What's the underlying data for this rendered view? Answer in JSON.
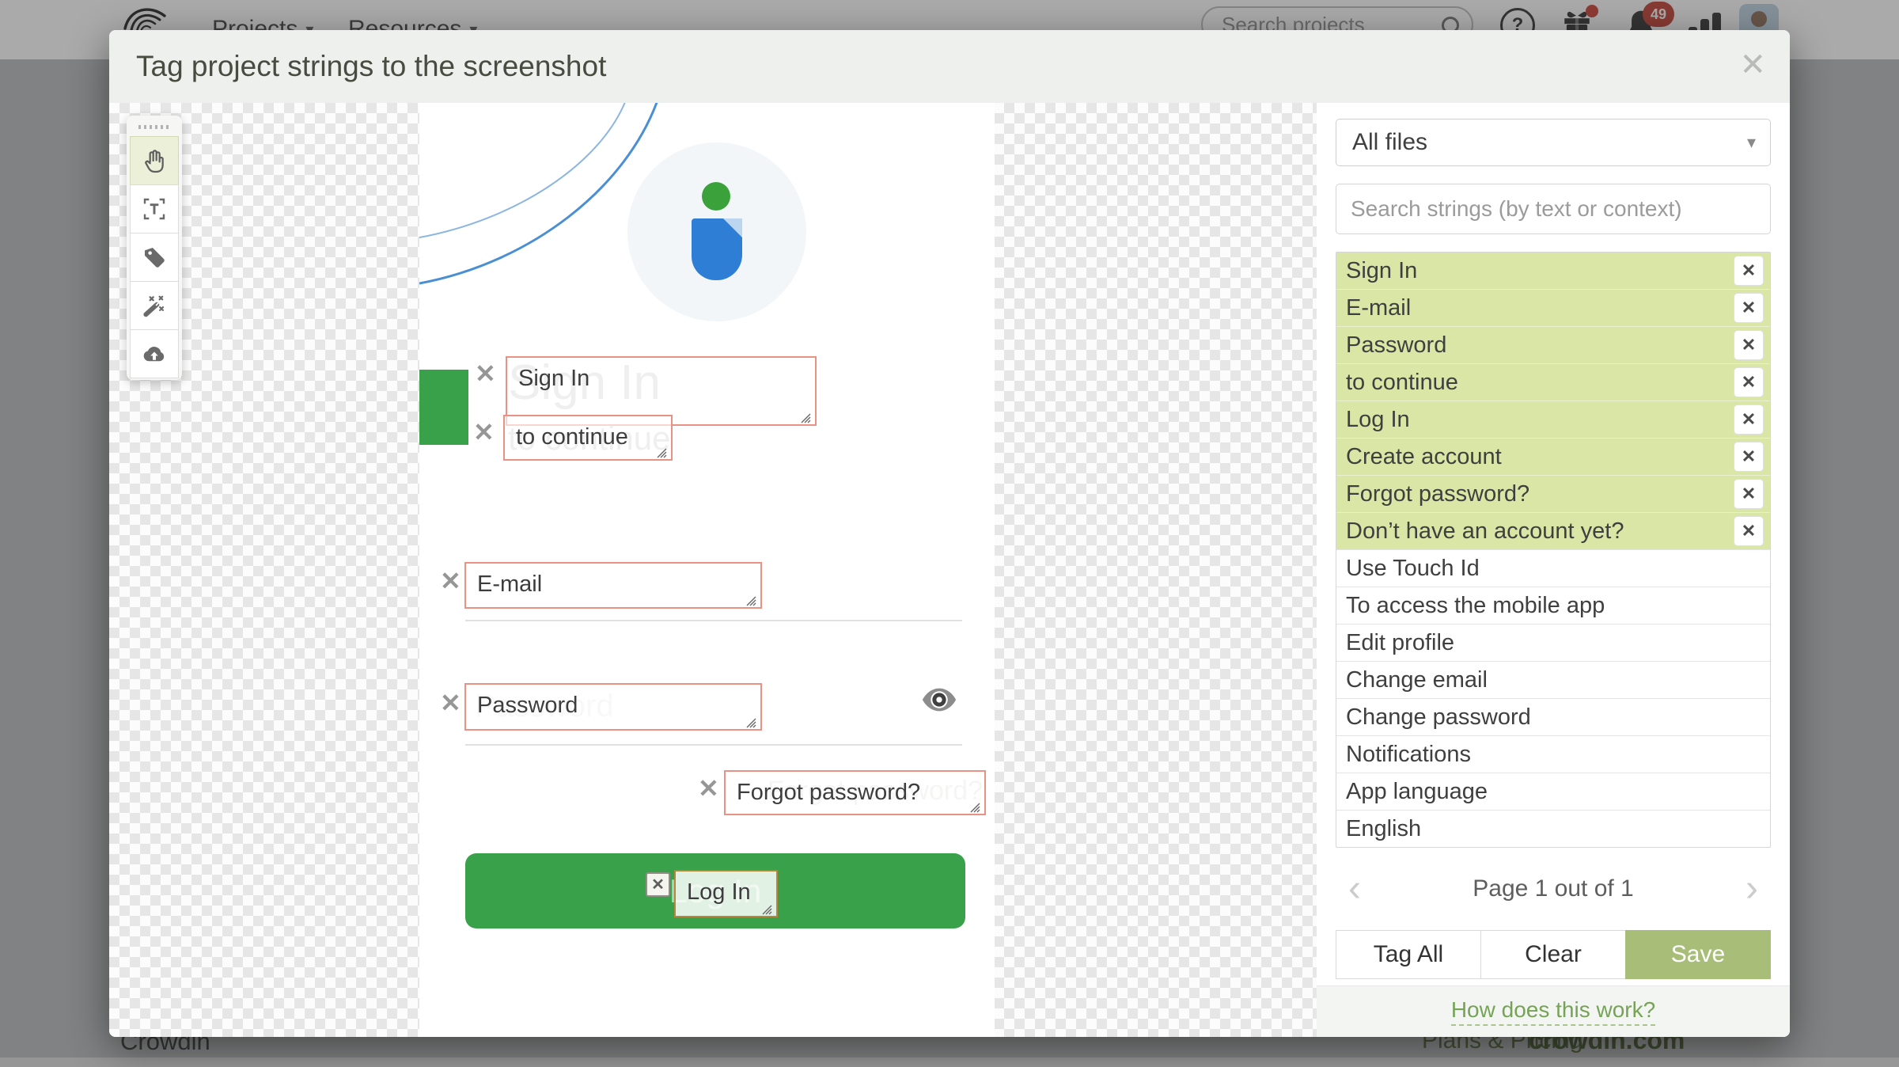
{
  "topbar": {
    "projects": "Projects",
    "resources": "Resources",
    "search_placeholder": "Search projects",
    "notification_count": "49"
  },
  "modal": {
    "title": "Tag project strings to the screenshot"
  },
  "screenshot": {
    "heading": "Sign In",
    "subheading": "to continue",
    "password_ghost": "Password",
    "forgot_ghost": "Forgot password?",
    "login_button": "Log In"
  },
  "tags": {
    "sign_in": "Sign In",
    "to_continue": "to continue",
    "email": "E-mail",
    "password": "Password",
    "forgot": "Forgot password?",
    "login": "Log In"
  },
  "panel": {
    "file_filter": "All files",
    "search_placeholder": "Search strings (by text or context)",
    "tagged": [
      "Sign In",
      "E-mail",
      "Password",
      "to continue",
      "Log In",
      "Create account",
      "Forgot password?",
      "Don’t have an account yet?"
    ],
    "untagged": [
      "Use Touch Id",
      "To access the mobile app",
      "Edit profile",
      "Change email",
      "Change password",
      "Notifications",
      "App language",
      "English"
    ],
    "pagination_label": "Page 1 out of 1",
    "tag_all": "Tag All",
    "clear": "Clear",
    "save": "Save",
    "help_link": "How does this work?"
  },
  "page_footer": {
    "brand": "Crowdin",
    "plans": "Plans & Pricing",
    "site": "crowdin.com"
  },
  "icons": {
    "close": "✕",
    "caret": "▾",
    "chevron_left": "‹",
    "chevron_right": "›",
    "question": "?"
  },
  "colors": {
    "app_green": "#38a14a",
    "tag_border": "#ea9186",
    "selected_tag_border": "#b5873c",
    "row_highlight": "#d9e6a6",
    "save_button": "#a7bd78",
    "link_green": "#76a356"
  }
}
